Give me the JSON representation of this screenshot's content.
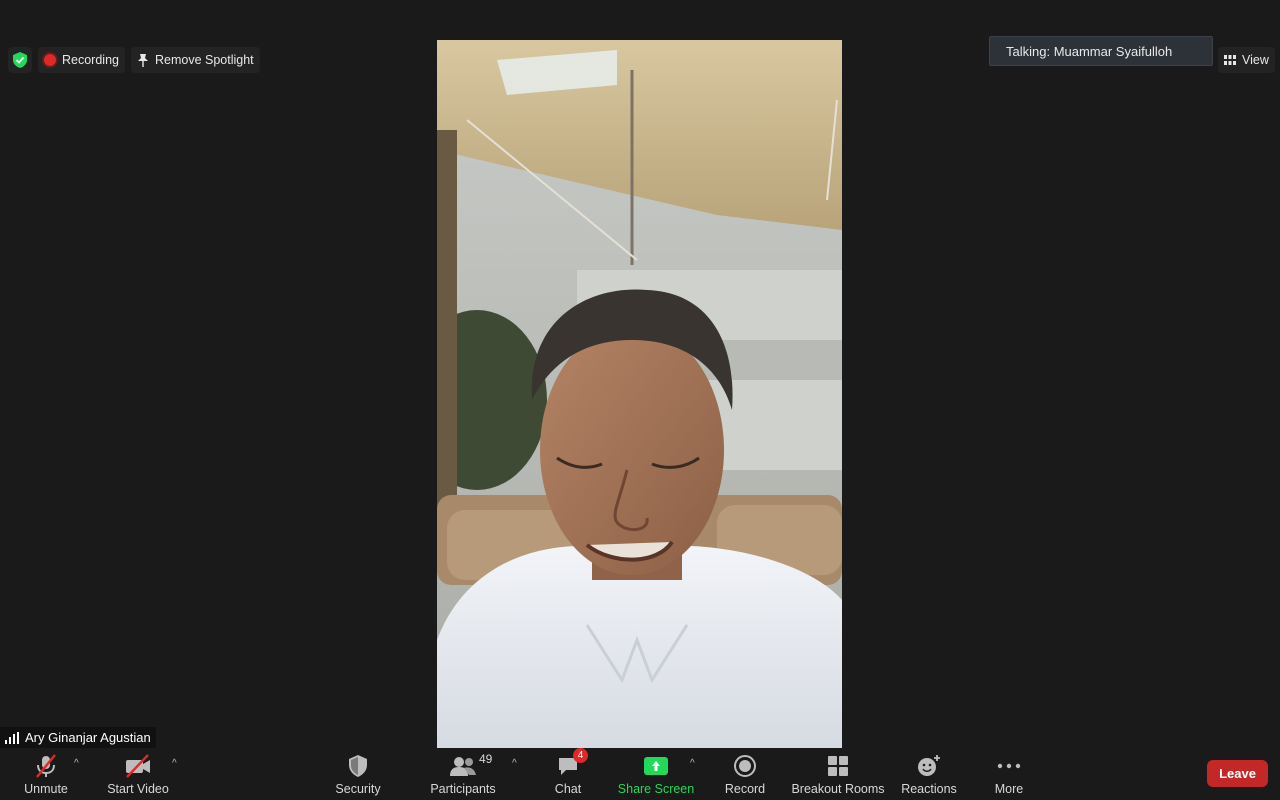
{
  "top_controls": {
    "recording_label": "Recording",
    "remove_spotlight_label": "Remove Spotlight"
  },
  "talking": {
    "text": "Talking: Muammar Syaifulloh"
  },
  "view": {
    "label": "View"
  },
  "participant": {
    "name": "Ary Ginanjar Agustian"
  },
  "toolbar": {
    "unmute_label": "Unmute",
    "start_video_label": "Start Video",
    "security_label": "Security",
    "participants_label": "Participants",
    "participants_count": "49",
    "chat_label": "Chat",
    "chat_badge": "4",
    "share_screen_label": "Share Screen",
    "record_label": "Record",
    "breakout_label": "Breakout Rooms",
    "reactions_label": "Reactions",
    "more_label": "More",
    "leave_label": "Leave"
  },
  "colors": {
    "background": "#1a1a1a",
    "recording_red": "#e02828",
    "share_green": "#23d959",
    "leave_red": "#c42727",
    "security_green": "#23d959"
  }
}
